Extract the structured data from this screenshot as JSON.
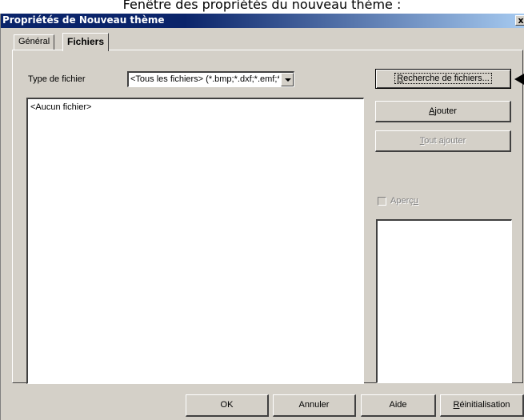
{
  "caption": "Fenêtre des propriétés du nouveau thème :",
  "window": {
    "title": "Propriétés de Nouveau thème",
    "close_glyph": "x"
  },
  "tabs": [
    {
      "label": "Général",
      "active": false
    },
    {
      "label": "Fichiers",
      "active": true
    }
  ],
  "file_type": {
    "label": "Type de fichier",
    "value": "<Tous les fichiers> (*.bmp;*.dxf;*.emf;*.eps;*.gif"
  },
  "file_list": {
    "items": [
      "<Aucun fichier>"
    ]
  },
  "buttons": {
    "search": {
      "pre": "",
      "accel": "R",
      "post": "echerche de fichiers..."
    },
    "add": {
      "pre": "",
      "accel": "A",
      "post": "jouter"
    },
    "add_all": {
      "pre": "",
      "accel": "T",
      "post": "out ajouter"
    },
    "ok": "OK",
    "cancel": "Annuler",
    "help": "Aide",
    "reset": {
      "pre": "",
      "accel": "R",
      "post": "éinitialisation"
    }
  },
  "preview": {
    "pre": "Aperç",
    "accel": "u",
    "post": "",
    "checked": false
  },
  "colors": {
    "titlebar_start": "#0a246a",
    "titlebar_end": "#a6caf0",
    "face": "#d4d0c8"
  }
}
